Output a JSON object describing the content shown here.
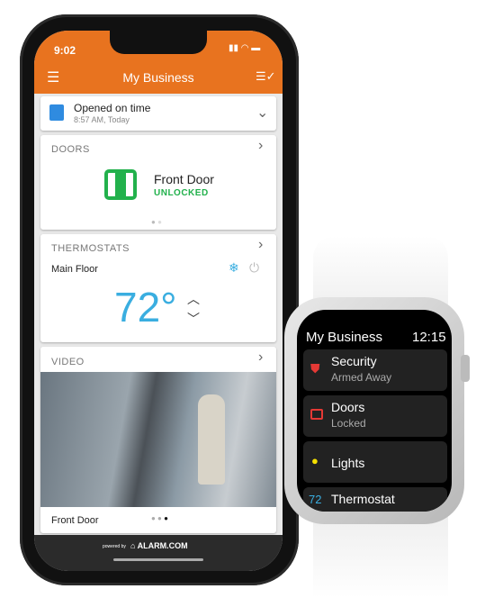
{
  "phone": {
    "status": {
      "time": "9:02"
    },
    "header": {
      "title": "My Business",
      "menu_icon": "hamburger-icon",
      "action_icon": "checklist-icon"
    },
    "schedule": {
      "title": "Opened on time",
      "subtitle": "8:57 AM, Today",
      "icon": "storefront-icon"
    },
    "doors": {
      "section": "DOORS",
      "name": "Front Door",
      "status": "UNLOCKED",
      "status_color": "#22b14c"
    },
    "thermostat": {
      "section": "THERMOSTATS",
      "location": "Main Floor",
      "temperature": "72°",
      "mode_icon": "snowflake-icon",
      "color": "#3aaee0"
    },
    "video": {
      "section": "VIDEO",
      "camera": "Front Door"
    },
    "footer": {
      "powered": "powered by",
      "brand": "ALARM.COM"
    },
    "accent": "#e8731f"
  },
  "watch": {
    "title": "My Business",
    "time": "12:15",
    "items": [
      {
        "label": "Security",
        "status": "Armed Away",
        "icon": "shield-icon"
      },
      {
        "label": "Doors",
        "status": "Locked",
        "icon": "door-icon"
      },
      {
        "label": "Lights",
        "icon": "lightbulb-icon"
      },
      {
        "value": "72",
        "label": "Thermostat"
      }
    ]
  }
}
